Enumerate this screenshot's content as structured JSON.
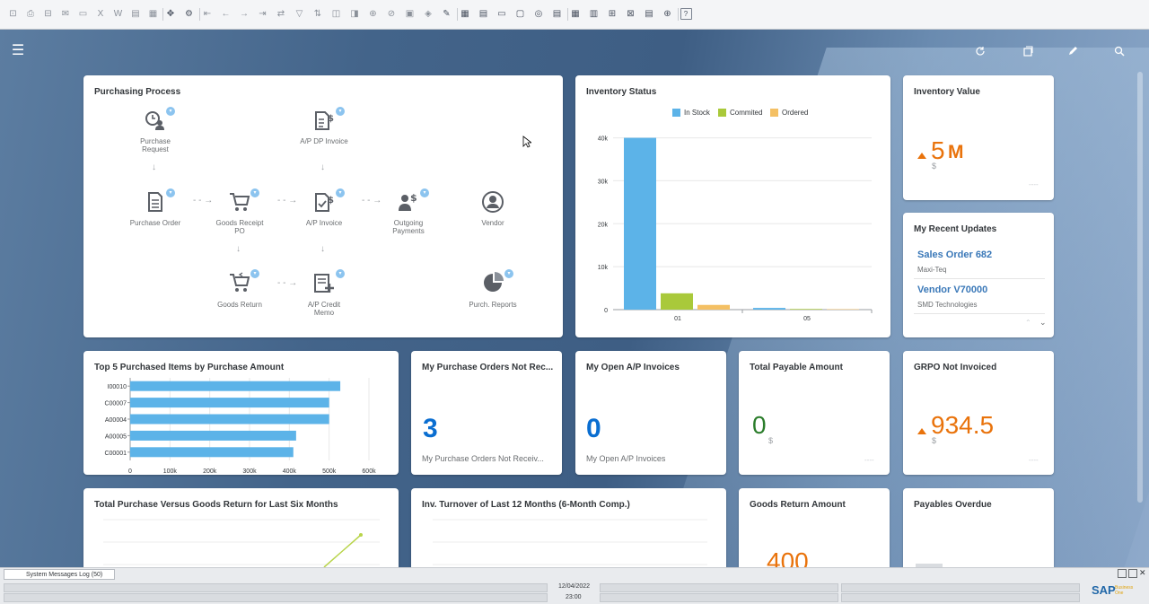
{
  "toolbar": {
    "icons": [
      "find-icon",
      "print-icon",
      "print-preview-icon",
      "email-icon",
      "sms-icon",
      "export-excel-icon",
      "export-word-icon",
      "export-pdf-icon",
      "lock-screen-icon",
      "move-icon",
      "settings-icon",
      "first-record-icon",
      "previous-record-icon",
      "next-record-icon",
      "last-record-icon",
      "refresh-icon",
      "filter-icon",
      "sort-icon",
      "base-document-icon",
      "target-document-icon",
      "related-icon",
      "gross-profit-icon",
      "trans-journal-icon",
      "payment-icon",
      "draft-icon",
      "calendar-icon",
      "query-icon",
      "message-icon",
      "activity-icon",
      "service-icon",
      "report-icon",
      "crystal-icon",
      "layout-icon",
      "attach-icon",
      "form-settings-icon",
      "workflow-icon",
      "browser-icon",
      "help-icon"
    ]
  },
  "header": {
    "menu_icon": "☰",
    "actions": [
      "refresh-icon",
      "copy-icon",
      "edit-icon",
      "search-icon"
    ]
  },
  "purchasing": {
    "title": "Purchasing Process",
    "nodes": {
      "purchase_request": "Purchase Request",
      "ap_dp_invoice": "A/P DP Invoice",
      "purchase_order": "Purchase Order",
      "goods_receipt_po": "Goods Receipt PO",
      "ap_invoice": "A/P Invoice",
      "outgoing_payments": "Outgoing Payments",
      "vendor": "Vendor",
      "goods_return": "Goods Return",
      "ap_credit_memo": "A/P Credit Memo",
      "purch_reports": "Purch. Reports"
    }
  },
  "inventory_status": {
    "title": "Inventory Status",
    "legend": [
      {
        "name": "In Stock",
        "color": "#5cb3e8"
      },
      {
        "name": "Commited",
        "color": "#a9c93a"
      },
      {
        "name": "Ordered",
        "color": "#f4c064"
      }
    ]
  },
  "inventory_value": {
    "title": "Inventory Value",
    "value": "5",
    "suffix": "M",
    "unit": "$",
    "dash": "----"
  },
  "recent_updates": {
    "title": "My Recent Updates",
    "items": [
      {
        "title": "Sales Order 682",
        "subtitle": "Maxi-Teq"
      },
      {
        "title": "Vendor V70000",
        "subtitle": "SMD Technologies"
      }
    ]
  },
  "top5": {
    "title": "Top 5 Purchased Items by Purchase Amount"
  },
  "po_not_received": {
    "title": "My Purchase Orders Not Rec...",
    "value": "3",
    "subtitle": "My Purchase Orders Not Receiv..."
  },
  "open_ap": {
    "title": "My Open A/P Invoices",
    "value": "0",
    "subtitle": "My Open A/P Invoices"
  },
  "total_payable": {
    "title": "Total Payable Amount",
    "value": "0",
    "unit": "$",
    "dash": "----"
  },
  "grpo": {
    "title": "GRPO Not Invoiced",
    "value": "934.5",
    "unit": "$",
    "dash": "----"
  },
  "purchase_vs_return": {
    "title": "Total Purchase Versus Goods Return for Last Six Months"
  },
  "inv_turnover": {
    "title": "Inv. Turnover of Last 12 Months (6-Month Comp.)"
  },
  "goods_return_amount": {
    "title": "Goods Return Amount",
    "value": "400"
  },
  "payables_overdue": {
    "title": "Payables Overdue"
  },
  "statusbar": {
    "sys_tab": "System Messages Log (50)",
    "date": "12/04/2022",
    "time": "23:00",
    "logo": "SAP",
    "logo_sub_1": "Business",
    "logo_sub_2": "One"
  },
  "colors": {
    "accent_blue": "#0a6ed1",
    "negative_orange": "#e9730c",
    "positive_green": "#2b7d2b"
  },
  "chart_data": [
    {
      "type": "bar",
      "title": "Inventory Status",
      "categories": [
        "01",
        "05"
      ],
      "series": [
        {
          "name": "In Stock",
          "values": [
            40000,
            400
          ]
        },
        {
          "name": "Commited",
          "values": [
            3800,
            150
          ]
        },
        {
          "name": "Ordered",
          "values": [
            1100,
            100
          ]
        }
      ],
      "ylim": [
        0,
        42000
      ],
      "yticks": [
        "0",
        "10k",
        "20k",
        "30k",
        "40k"
      ],
      "ytick_values": [
        0,
        10000,
        20000,
        30000,
        40000
      ],
      "grid": true,
      "legend": "top-center"
    },
    {
      "type": "bar",
      "orientation": "horizontal",
      "title": "Top 5 Purchased Items by Purchase Amount",
      "categories": [
        "I00010",
        "C00007",
        "A00004",
        "A00005",
        "C00001"
      ],
      "values": [
        528000,
        500000,
        500000,
        417000,
        410000
      ],
      "xlim": [
        0,
        600000
      ],
      "xticks": [
        "0",
        "100k",
        "200k",
        "300k",
        "400k",
        "500k",
        "600k"
      ],
      "xtick_values": [
        0,
        100000,
        200000,
        300000,
        400000,
        500000,
        600000
      ],
      "grid": true
    }
  ]
}
